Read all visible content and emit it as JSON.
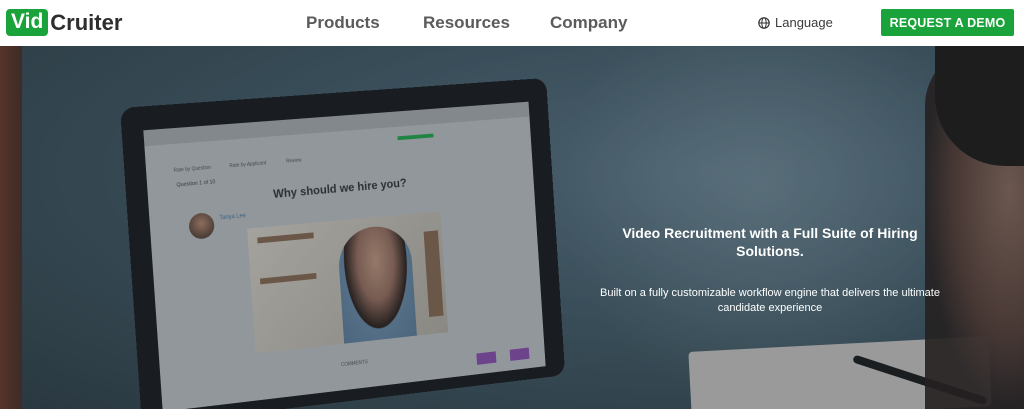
{
  "nav": {
    "logo_part1": "Vid",
    "logo_part2": "Cruiter",
    "links": [
      "Products",
      "Resources",
      "Company"
    ],
    "language_label": "Language",
    "language_icon": "globe-icon",
    "cta_label": "REQUEST A DEMO",
    "brand_color": "#1aa33a"
  },
  "hero": {
    "heading": "Video Recruitment with a Full Suite of Hiring Solutions.",
    "subheading": "Built on a fully customizable workflow engine that delivers the ultimate candidate experience"
  },
  "laptop_screen": {
    "tabs": [
      "Rate by Question",
      "Rate by Applicant",
      "Review"
    ],
    "question_counter": "Question 1 of 10",
    "question_title": "Why should we hire you?",
    "candidate_name": "Tanya Lee",
    "comments_label": "COMMENTS"
  }
}
